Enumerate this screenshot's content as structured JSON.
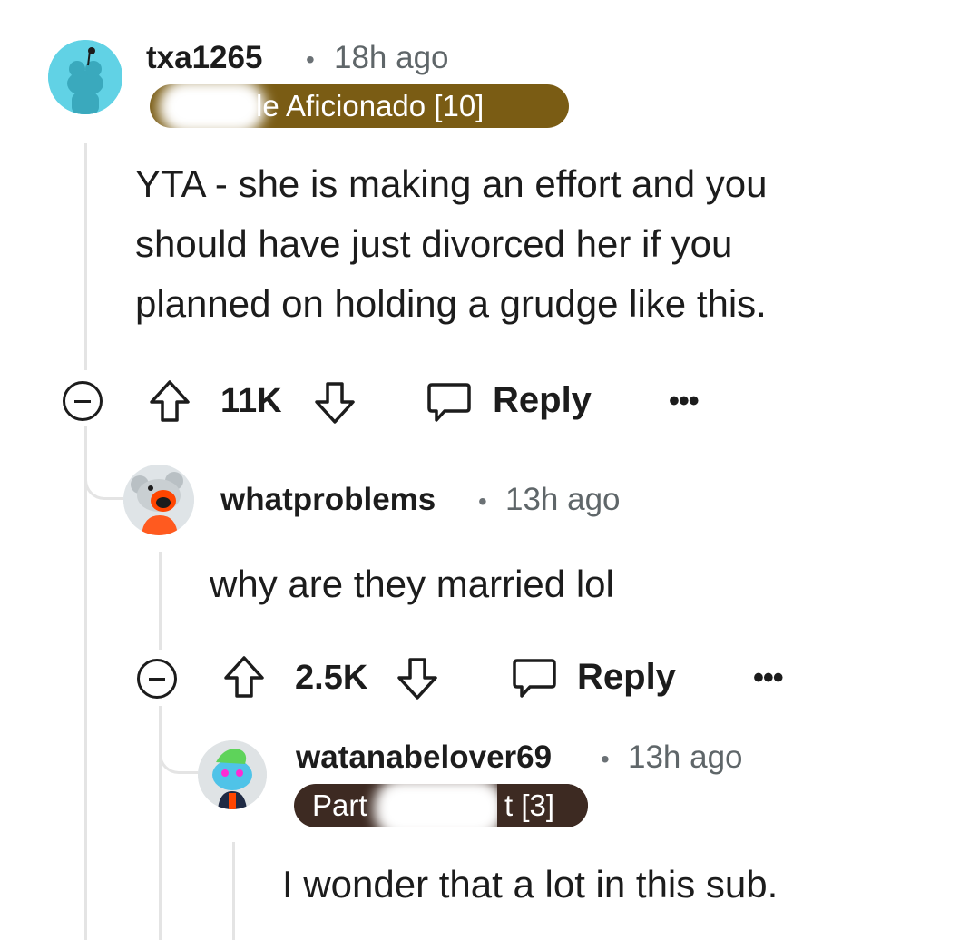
{
  "comments": [
    {
      "username": "txa1265",
      "separator": "•",
      "time": "18h ago",
      "flair": "le Aficionado [10]",
      "flair_color": "#7a5c14",
      "body": "YTA - she is making an effort and you should have just divorced her if you planned on holding a grudge like this.",
      "score": "11K",
      "reply_label": "Reply",
      "more_label": "•••",
      "avatar_icon": "snoo-avatar-teal"
    },
    {
      "username": "whatproblems",
      "separator": "•",
      "time": "13h ago",
      "body": "why are they married lol",
      "score": "2.5K",
      "reply_label": "Reply",
      "more_label": "•••",
      "avatar_icon": "snoo-avatar-orange-hoodie"
    },
    {
      "username": "watanabelover69",
      "separator": "•",
      "time": "13h ago",
      "flair_left": "Part",
      "flair_right": "t [3]",
      "flair_color": "#3d2a22",
      "body": "I wonder that a lot in this sub.",
      "avatar_icon": "snoo-avatar-blue-green-hair"
    }
  ],
  "colors": {
    "thread_line": "#e4e4e4",
    "text": "#1c1c1c",
    "meta": "#5f6669"
  }
}
